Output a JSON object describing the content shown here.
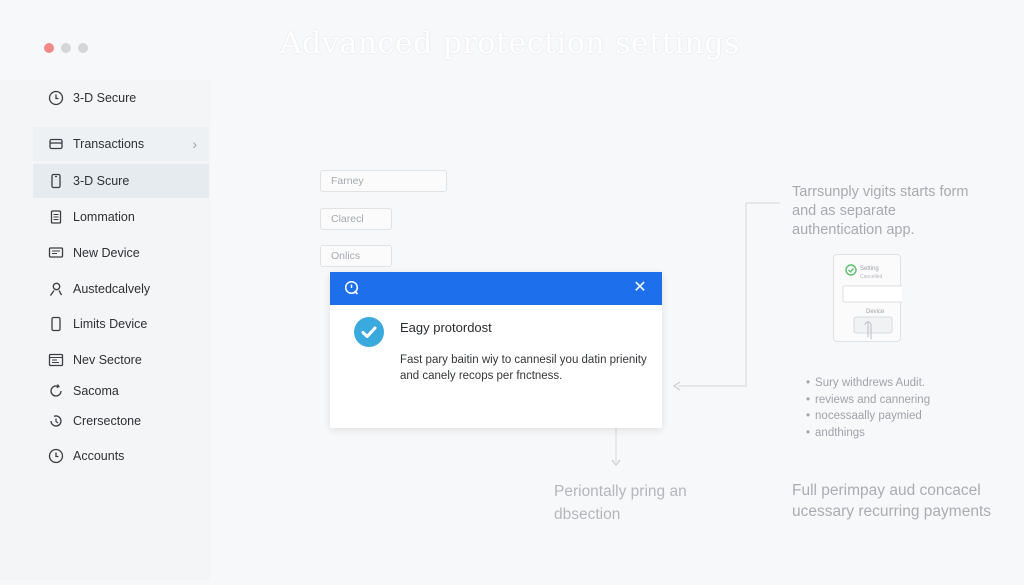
{
  "window": {
    "title": "Advanced protection settings"
  },
  "sidebar": {
    "items": [
      {
        "label": "3-D Secure",
        "icon": "clock-icon"
      },
      {
        "label": "Transactions",
        "icon": "card-icon"
      },
      {
        "label": "3-D Scure",
        "icon": "phone-icon"
      },
      {
        "label": "Lommation",
        "icon": "document-icon"
      },
      {
        "label": "New Device",
        "icon": "monitor-icon"
      },
      {
        "label": "Austedcalvely",
        "icon": "user-icon"
      },
      {
        "label": "Limits Device",
        "icon": "mobile-icon"
      },
      {
        "label": "Nev Sectore",
        "icon": "window-icon"
      },
      {
        "label": "Sacoma",
        "icon": "refresh-icon"
      },
      {
        "label": "Crersectone",
        "icon": "history-icon"
      },
      {
        "label": "Accounts",
        "icon": "clock-icon"
      }
    ]
  },
  "form": {
    "fields": [
      {
        "placeholder": "Farney"
      },
      {
        "placeholder": "Clarecl"
      },
      {
        "placeholder": "Onlics"
      }
    ]
  },
  "dialog": {
    "title": "Eagy protordost",
    "body": "Fast pary baitin wiy to cannesil you datin prienity and canely recops per fnctness.",
    "close_label": "✕",
    "header_color": "#1e6fec",
    "badge_color": "#3aa9de"
  },
  "info": {
    "right_text": "Tarrsunply vigits starts form and as separate authentication app.",
    "phone": {
      "line1": "Setting",
      "line2": "Cancelled",
      "button": "Device"
    },
    "bullets": [
      "Sury withdrews Audit.",
      "reviews and cannering",
      "nocessaally paymied",
      "andthings"
    ],
    "bottom_left": "Periontally pring an dbsection",
    "bottom_right": "Full perimpay aud concacel ucessary recurring payments"
  }
}
